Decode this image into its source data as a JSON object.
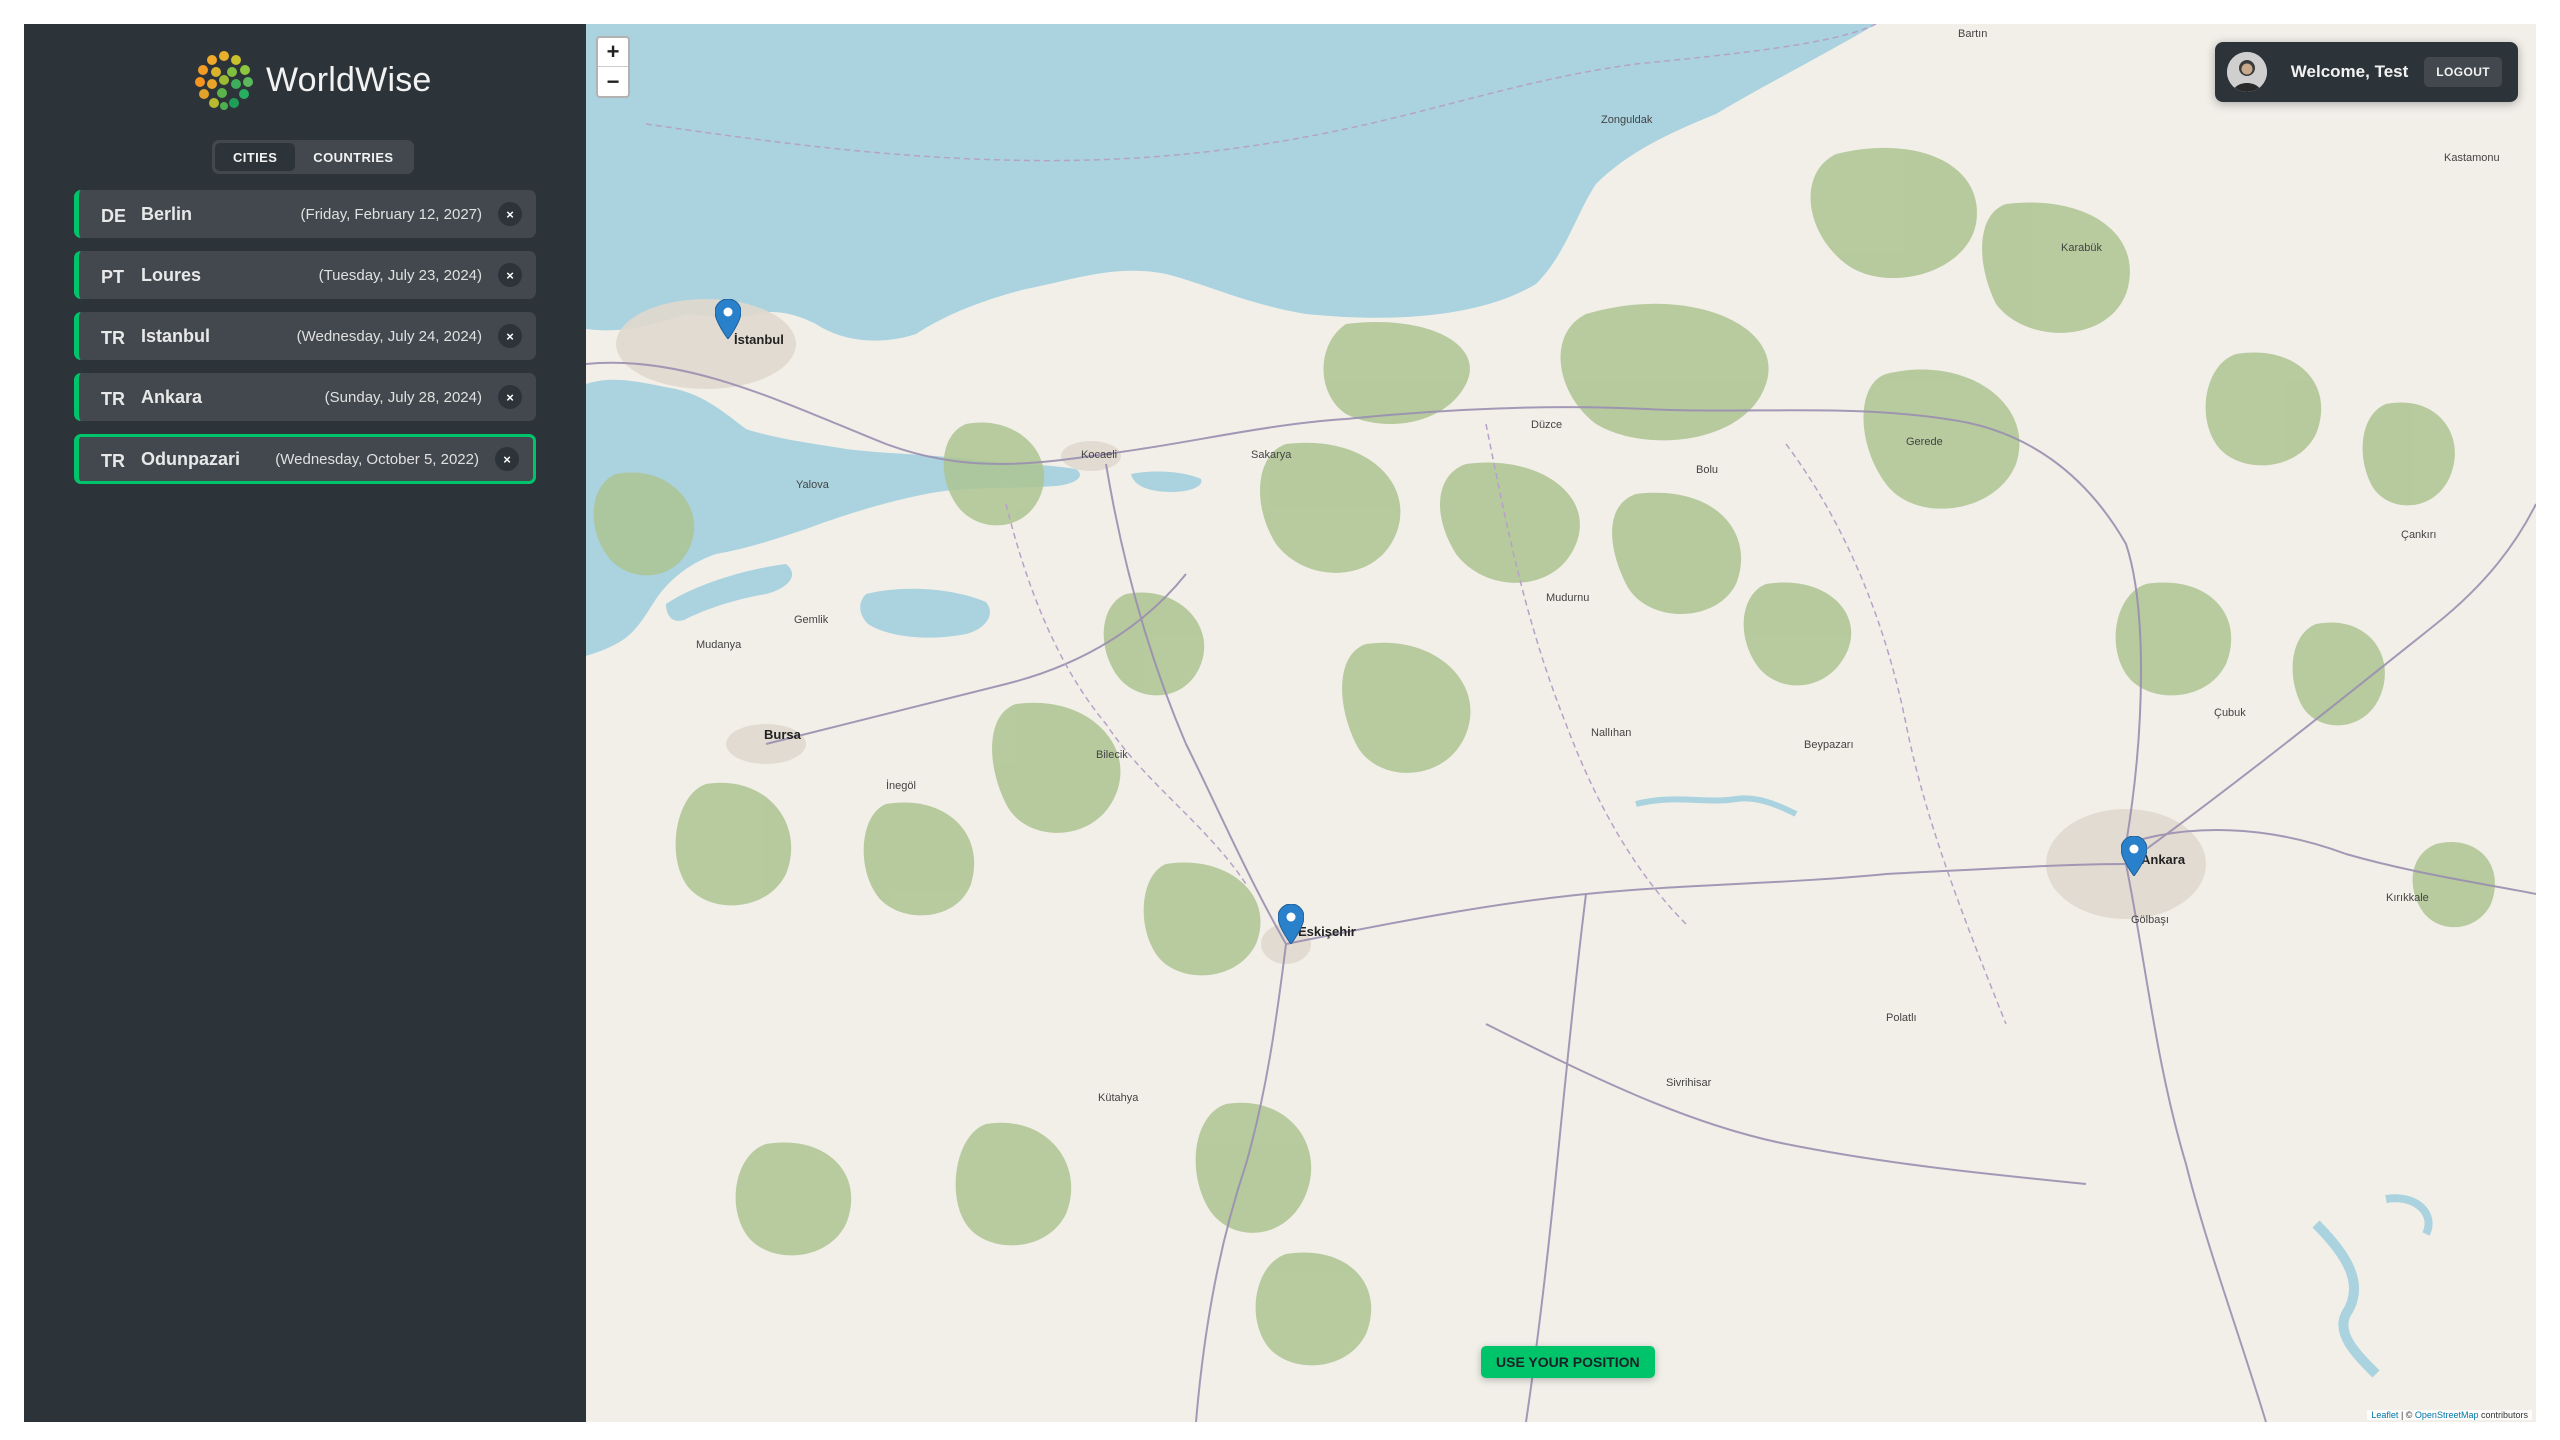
{
  "app": {
    "name": "WorldWise"
  },
  "tabs": [
    {
      "label": "CITIES",
      "active": true
    },
    {
      "label": "COUNTRIES",
      "active": false
    }
  ],
  "cities": [
    {
      "code": "DE",
      "name": "Berlin",
      "date": "(Friday, February 12, 2027)",
      "delete": "×"
    },
    {
      "code": "PT",
      "name": "Loures",
      "date": "(Tuesday, July 23, 2024)",
      "delete": "×"
    },
    {
      "code": "TR",
      "name": "Istanbul",
      "date": "(Wednesday, July 24, 2024)",
      "delete": "×"
    },
    {
      "code": "TR",
      "name": "Ankara",
      "date": "(Sunday, July 28, 2024)",
      "delete": "×"
    },
    {
      "code": "TR",
      "name": "Odunpazari",
      "date": "(Wednesday, October 5, 2022)",
      "delete": "×",
      "selected": true
    }
  ],
  "map": {
    "zoom_in": "+",
    "zoom_out": "−",
    "use_position": "USE YOUR POSITION",
    "attribution_leaflet": "Leaflet",
    "attribution_sep": " | © ",
    "attribution_osm": "OpenStreetMap",
    "attribution_tail": " contributors",
    "places": {
      "istanbul": "İstanbul",
      "bursa": "Bursa",
      "eskisehir": "Eskişehir",
      "ankara": "Ankara",
      "kocaeli": "Kocaeli",
      "sakarya": "Sakarya",
      "duzce": "Düzce",
      "bolu": "Bolu",
      "bilecik": "Bilecik",
      "kutahya": "Kütahya",
      "kirikkale": "Kırıkkale",
      "cankiri": "Çankırı",
      "zonguldak": "Zonguldak",
      "karabuk": "Karabük",
      "kastamonu": "Kastamonu",
      "bartin": "Bartın",
      "mudurnu": "Mudurnu",
      "beypazari": "Beypazarı",
      "polatli": "Polatlı",
      "sivrihisar": "Sivrihisar",
      "gemlik": "Gemlik",
      "yalova": "Yalova",
      "mudanya": "Mudanya",
      "inegol": "İnegöl",
      "gerede": "Gerede",
      "nallihan": "Nallıhan",
      "cubuk": "Çubuk",
      "golbasi": "Gölbaşı"
    }
  },
  "user": {
    "welcome": "Welcome, Test",
    "logout": "LOGOUT"
  },
  "colors": {
    "accent": "#00c46a",
    "sidebar": "#2d3439",
    "panel": "#42484d",
    "sea": "#aad3df",
    "forest": "#adc492",
    "land": "#f2efe9"
  },
  "icons": {
    "zoom_in": "plus-icon",
    "zoom_out": "minus-icon",
    "delete": "close-icon",
    "marker": "map-pin-icon",
    "avatar": "user-avatar"
  }
}
